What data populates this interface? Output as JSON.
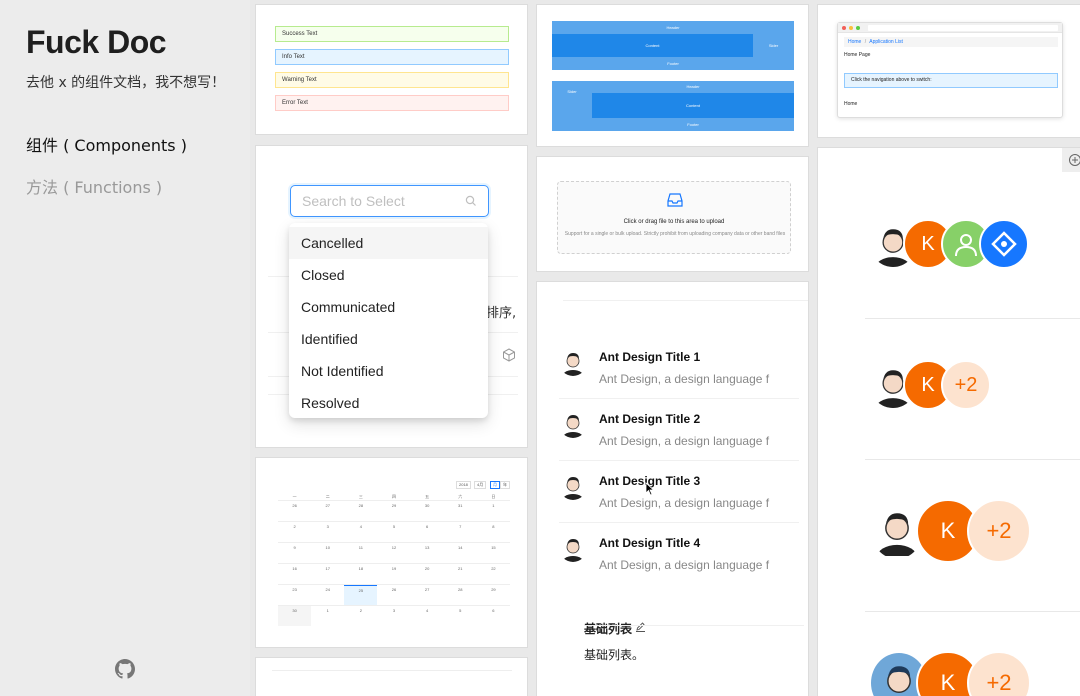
{
  "sidebar": {
    "brand": "Fuck Doc",
    "tagline": "去他 x 的组件文档，我不想写！",
    "nav_components": "组件 ( Components )",
    "nav_functions": "方法 ( Functions )"
  },
  "alerts": {
    "success": "Success Text",
    "info": "Info Text",
    "warning": "Warning Text",
    "error": "Error Text"
  },
  "select": {
    "placeholder": "Search to Select",
    "options": [
      "Cancelled",
      "Closed",
      "Communicated",
      "Identified",
      "Not Identified",
      "Resolved"
    ],
    "background_fragment": "排序,"
  },
  "calendar": {
    "controls": [
      "2018",
      "4月",
      "月",
      "年"
    ],
    "weekdays": [
      "一",
      "二",
      "三",
      "四",
      "五",
      "六",
      "日"
    ],
    "rows": [
      [
        "26",
        "27",
        "28",
        "29",
        "30",
        "31",
        "1"
      ],
      [
        "2",
        "3",
        "4",
        "5",
        "6",
        "7",
        "8"
      ],
      [
        "9",
        "10",
        "11",
        "12",
        "13",
        "14",
        "15"
      ],
      [
        "16",
        "17",
        "18",
        "19",
        "20",
        "21",
        "22"
      ],
      [
        "23",
        "24",
        "25",
        "26",
        "27",
        "28",
        "29"
      ],
      [
        "30",
        "1",
        "2",
        "3",
        "4",
        "5",
        "6"
      ]
    ]
  },
  "layout": {
    "header": "Header",
    "content": "Content",
    "sider": "Sider",
    "footer": "Footer"
  },
  "upload": {
    "title": "Click or drag file to this area to upload",
    "hint": "Support for a single or bulk upload. Strictly prohibit from uploading company data or other band files"
  },
  "list": {
    "items": [
      {
        "title": "Ant Design Title 1",
        "desc": "Ant Design, a design language f"
      },
      {
        "title": "Ant Design Title 2",
        "desc": "Ant Design, a design language f"
      },
      {
        "title": "Ant Design Title 3",
        "desc": "Ant Design, a design language f"
      },
      {
        "title": "Ant Design Title 4",
        "desc": "Ant Design, a design language f"
      }
    ],
    "section_title": "基础列表",
    "section_text": "基础列表。"
  },
  "breadcrumb_demo": {
    "crumb_home": "Home",
    "crumb_app": "Application List",
    "page_top": "Home Page",
    "info": "Click the navigation above to switch:",
    "page_bottom": "Home"
  },
  "avatars": {
    "k_letter": "K",
    "more_count": "+2"
  },
  "colors": {
    "primary": "#1677ff",
    "avatar_orange": "#f56a00",
    "avatar_peach": "#fde3cf",
    "avatar_green": "#87d068"
  }
}
